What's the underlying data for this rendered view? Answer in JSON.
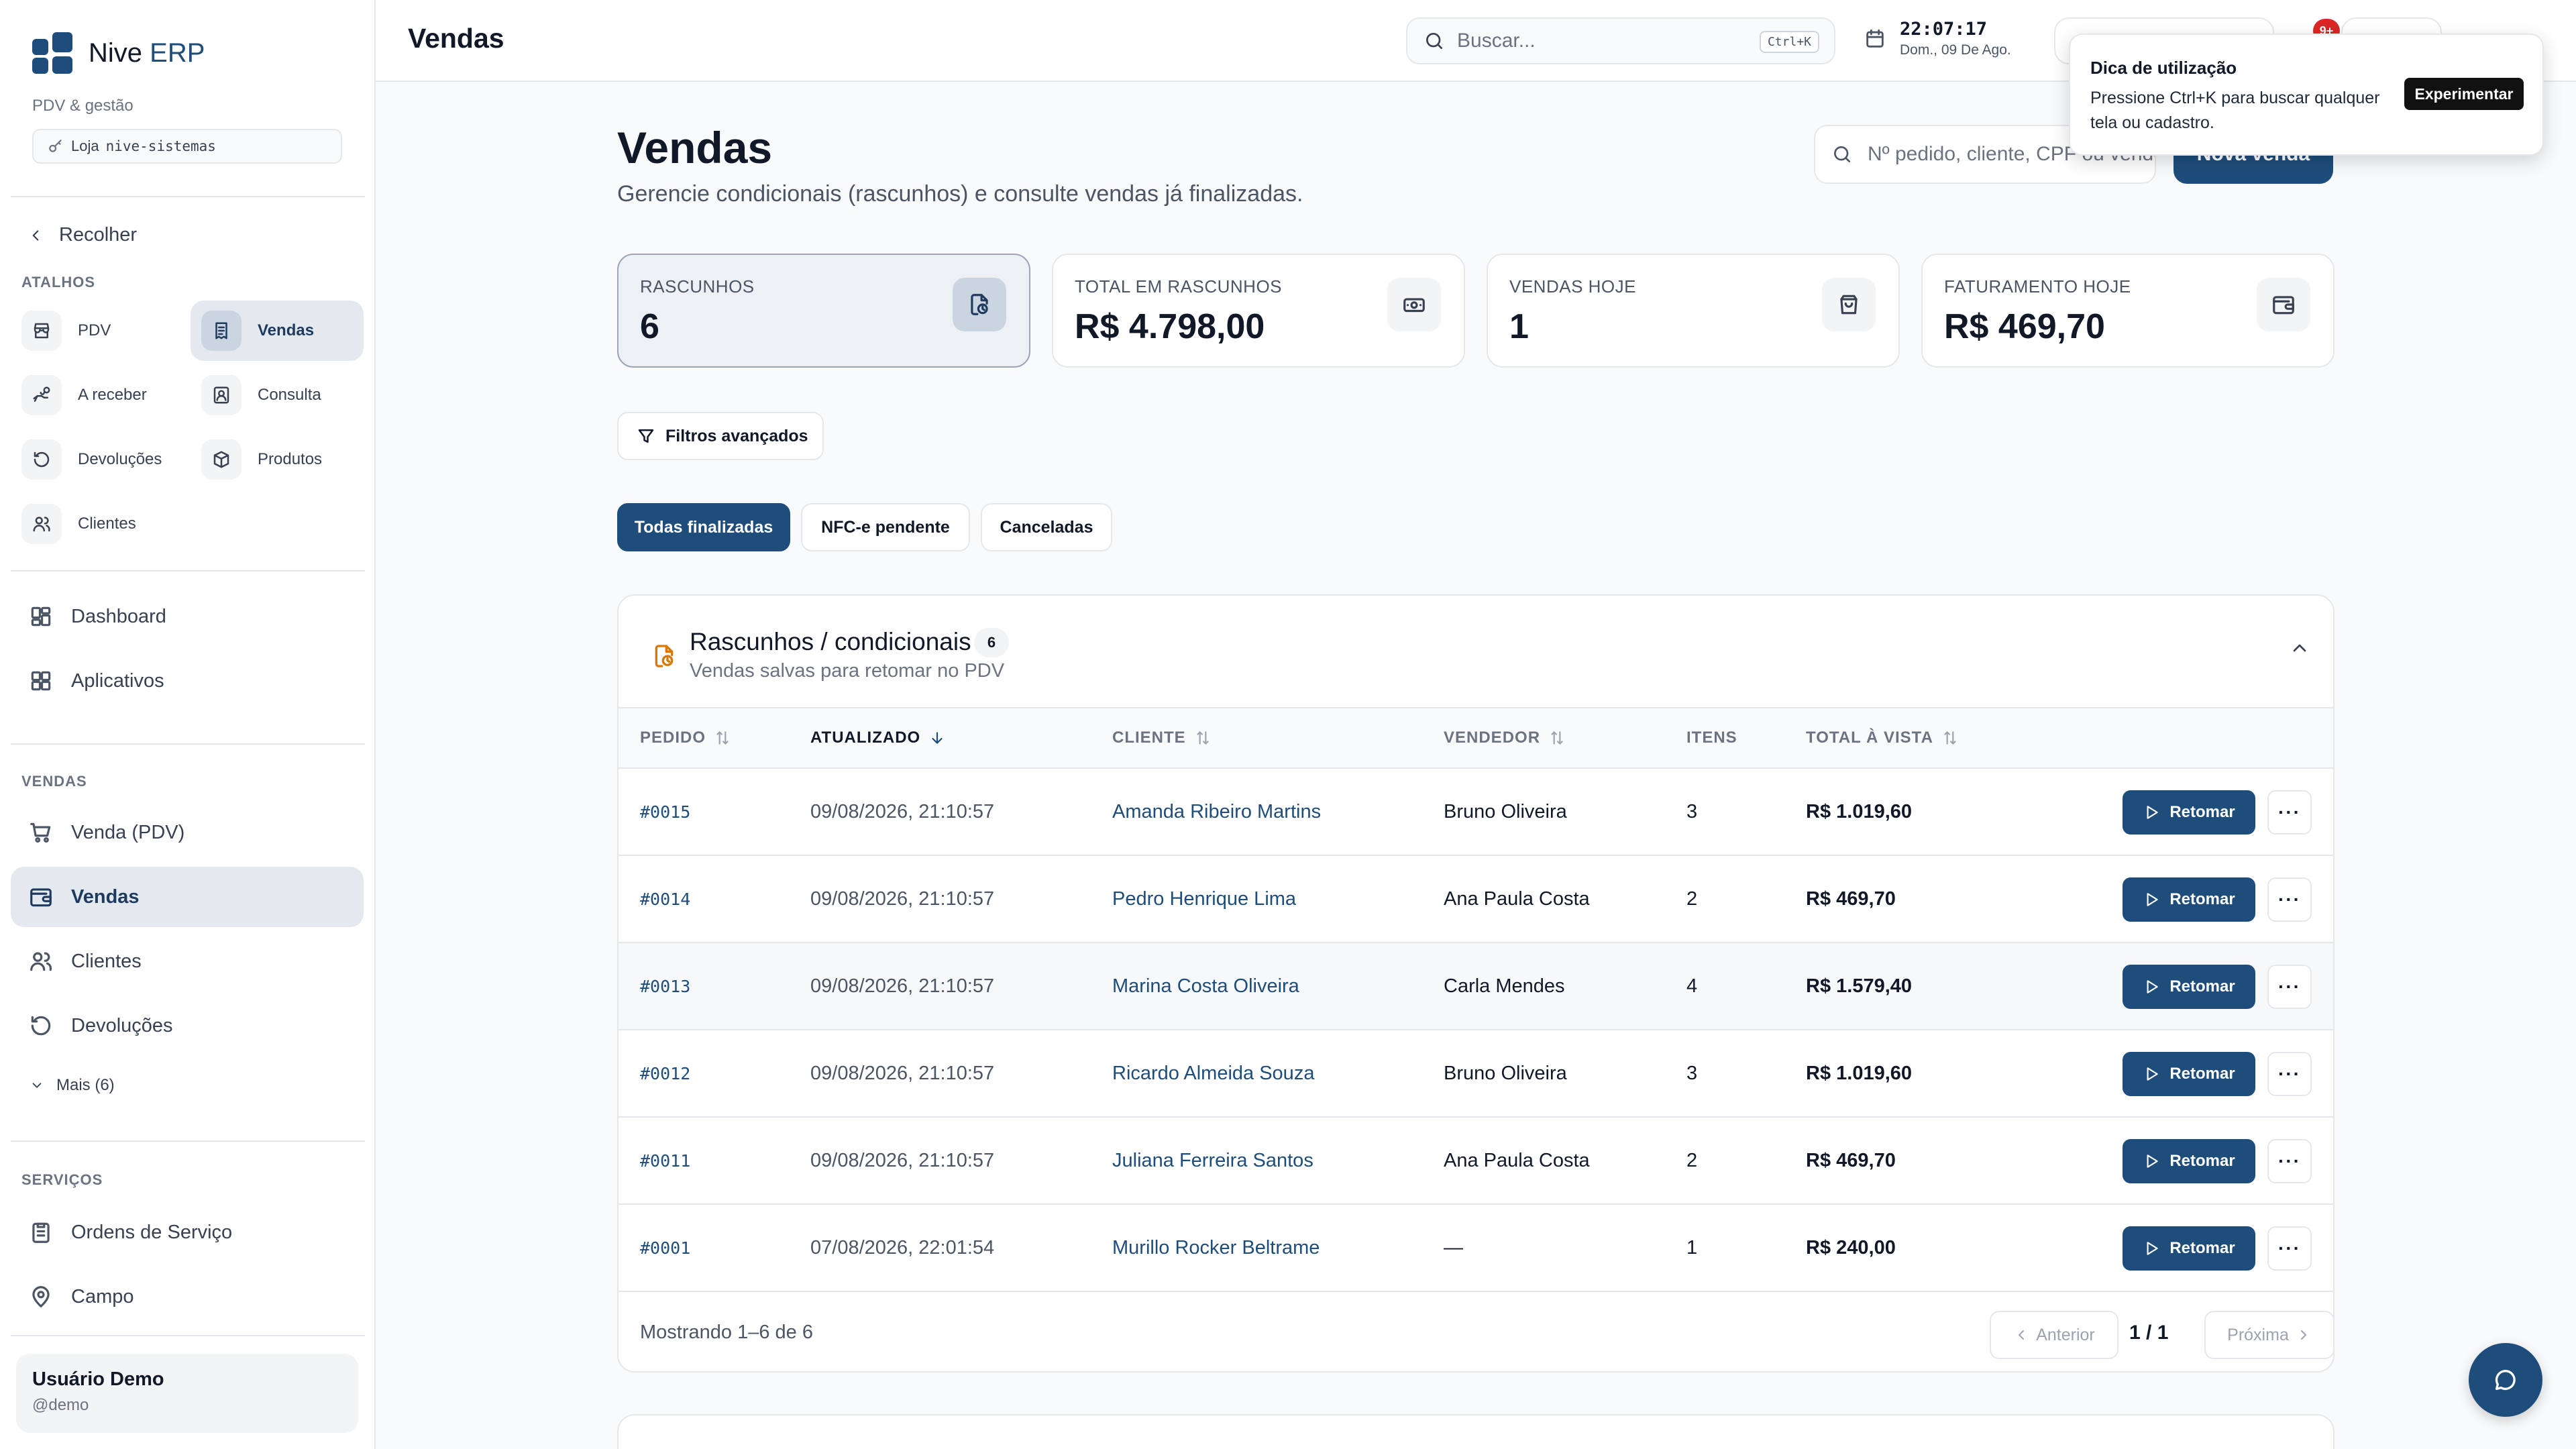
{
  "brand": {
    "name_main": "Nive",
    "name_accent": "ERP",
    "subtitle": "PDV & gestão",
    "store_label": "Loja",
    "store_code": "nive-sistemas"
  },
  "sidebar": {
    "collapse_label": "Recolher",
    "shortcuts_title": "ATALHOS",
    "shortcuts": [
      {
        "label": "PDV",
        "icon": "store-icon"
      },
      {
        "label": "Vendas",
        "icon": "receipt-icon",
        "active": true
      },
      {
        "label": "A receber",
        "icon": "hand-coins-icon"
      },
      {
        "label": "Consulta",
        "icon": "user-search-icon"
      },
      {
        "label": "Devoluções",
        "icon": "undo-icon"
      },
      {
        "label": "Produtos",
        "icon": "package-icon"
      },
      {
        "label": "Clientes",
        "icon": "users-icon"
      }
    ],
    "main_items": [
      {
        "label": "Dashboard",
        "icon": "grid-icon"
      },
      {
        "label": "Aplicativos",
        "icon": "apps-icon"
      }
    ],
    "sales_title": "VENDAS",
    "sales_items": [
      {
        "label": "Venda (PDV)",
        "icon": "cart-icon"
      },
      {
        "label": "Vendas",
        "icon": "wallet-icon",
        "active": true
      },
      {
        "label": "Clientes",
        "icon": "users-icon"
      },
      {
        "label": "Devoluções",
        "icon": "undo-icon"
      }
    ],
    "more_label": "Mais (6)",
    "services_title": "SERVIÇOS",
    "services_items": [
      {
        "label": "Ordens de Serviço",
        "icon": "clipboard-icon"
      },
      {
        "label": "Campo",
        "icon": "map-pin-icon"
      }
    ],
    "user": {
      "name": "Usuário Demo",
      "handle": "@demo"
    }
  },
  "topbar": {
    "title": "Vendas",
    "search_placeholder": "Buscar...",
    "search_kbd": "Ctrl+K",
    "time": "22:07:17",
    "date": "Dom., 09 De Ago.",
    "notifications_badge": "9+"
  },
  "tooltip": {
    "title": "Dica de utilização",
    "body": "Pressione Ctrl+K para buscar qualquer tela ou cadastro.",
    "button": "Experimentar"
  },
  "page": {
    "title": "Vendas",
    "subtitle": "Gerencie condicionais (rascunhos) e consulte vendas já finalizadas.",
    "search_placeholder": "Nº pedido, cliente, CPF ou vendedor",
    "new_sale_label": "Nova venda"
  },
  "stats": [
    {
      "label": "RASCUNHOS",
      "value": "6",
      "icon": "draft-icon",
      "active": true
    },
    {
      "label": "TOTAL EM RASCUNHOS",
      "value": "R$ 4.798,00",
      "icon": "cash-icon"
    },
    {
      "label": "VENDAS HOJE",
      "value": "1",
      "icon": "shopping-bag-icon"
    },
    {
      "label": "FATURAMENTO HOJE",
      "value": "R$ 469,70",
      "icon": "wallet-icon"
    }
  ],
  "filters_label": "Filtros avançados",
  "tabs": [
    {
      "label": "Todas finalizadas",
      "active": true
    },
    {
      "label": "NFC-e pendente"
    },
    {
      "label": "Canceladas"
    }
  ],
  "drafts": {
    "title": "Rascunhos / condicionais",
    "count": "6",
    "subtitle": "Vendas salvas para retomar no PDV",
    "columns": [
      "PEDIDO",
      "ATUALIZADO",
      "CLIENTE",
      "VENDEDOR",
      "ITENS",
      "TOTAL À VISTA"
    ],
    "resume_label": "Retomar",
    "more_label": "···",
    "rows": [
      {
        "order": "#0015",
        "updated": "09/08/2026, 21:10:57",
        "client": "Amanda Ribeiro Martins",
        "seller": "Bruno Oliveira",
        "items": "3",
        "total": "R$ 1.019,60"
      },
      {
        "order": "#0014",
        "updated": "09/08/2026, 21:10:57",
        "client": "Pedro Henrique Lima",
        "seller": "Ana Paula Costa",
        "items": "2",
        "total": "R$ 469,70"
      },
      {
        "order": "#0013",
        "updated": "09/08/2026, 21:10:57",
        "client": "Marina Costa Oliveira",
        "seller": "Carla Mendes",
        "items": "4",
        "total": "R$ 1.579,40"
      },
      {
        "order": "#0012",
        "updated": "09/08/2026, 21:10:57",
        "client": "Ricardo Almeida Souza",
        "seller": "Bruno Oliveira",
        "items": "3",
        "total": "R$ 1.019,60"
      },
      {
        "order": "#0011",
        "updated": "09/08/2026, 21:10:57",
        "client": "Juliana Ferreira Santos",
        "seller": "Ana Paula Costa",
        "items": "2",
        "total": "R$ 469,70"
      },
      {
        "order": "#0001",
        "updated": "07/08/2026, 22:01:54",
        "client": "Murillo Rocker Beltrame",
        "seller": "—",
        "items": "1",
        "total": "R$ 240,00"
      }
    ],
    "showing": "Mostrando 1–6 de 6",
    "prev_label": "Anterior",
    "next_label": "Próxima",
    "page_indicator": "1 / 1"
  },
  "colors": {
    "accent": "#1e4d7b",
    "badge": "#dc2626",
    "draft_icon": "#d97706"
  }
}
